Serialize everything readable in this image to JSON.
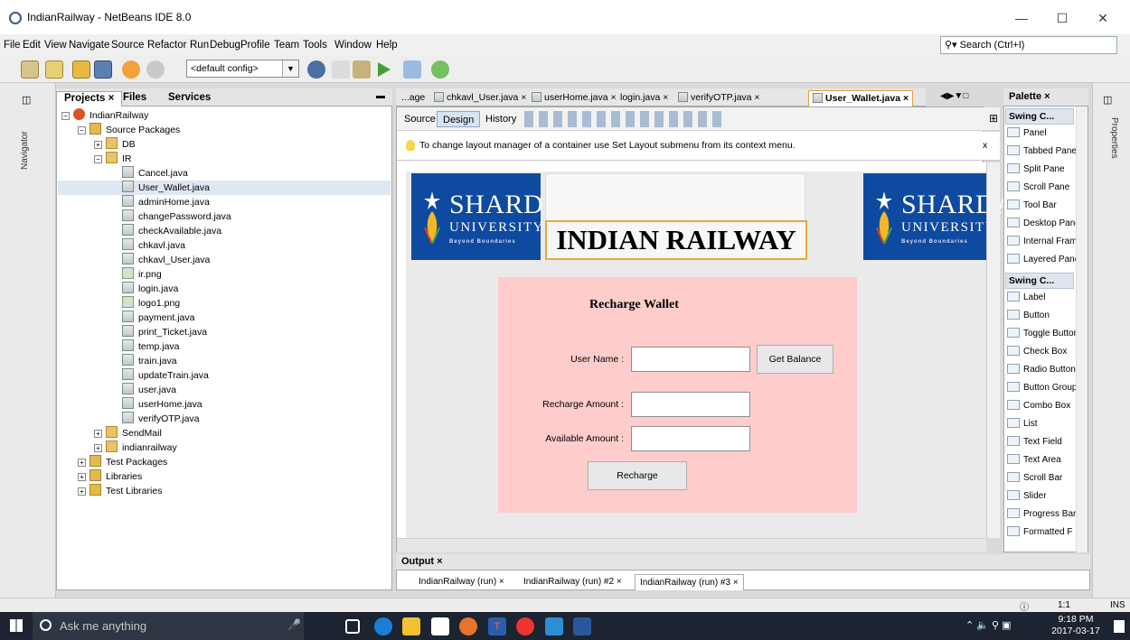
{
  "window": {
    "title": "IndianRailway - NetBeans IDE 8.0",
    "minimize": "—",
    "maximize": "☐",
    "close": "✕"
  },
  "menu": [
    "File",
    "Edit",
    "View",
    "Navigate",
    "Source",
    "Refactor",
    "Run",
    "Debug",
    "Profile",
    "Team",
    "Tools",
    "Window",
    "Help"
  ],
  "search": {
    "placeholder": "Search (Ctrl+I)"
  },
  "toolbar": {
    "config": "<default config>"
  },
  "left_strip": {
    "navigator": "Navigator"
  },
  "projects_panel": {
    "tabs": [
      "Projects ×",
      "Files",
      "Services"
    ],
    "tree": [
      {
        "label": "IndianRailway",
        "type": "proj",
        "level": 0,
        "exp": "−"
      },
      {
        "label": "Source Packages",
        "type": "folder",
        "level": 1,
        "exp": "−"
      },
      {
        "label": "DB",
        "type": "pkg",
        "level": 2,
        "exp": "+"
      },
      {
        "label": "IR",
        "type": "pkg",
        "level": 2,
        "exp": "−"
      },
      {
        "label": "Cancel.java",
        "type": "file",
        "level": 3
      },
      {
        "label": "User_Wallet.java",
        "type": "file",
        "level": 3,
        "selected": true
      },
      {
        "label": "adminHome.java",
        "type": "file",
        "level": 3
      },
      {
        "label": "changePassword.java",
        "type": "file",
        "level": 3
      },
      {
        "label": "checkAvailable.java",
        "type": "file",
        "level": 3
      },
      {
        "label": "chkavl.java",
        "type": "file",
        "level": 3
      },
      {
        "label": "chkavl_User.java",
        "type": "file",
        "level": 3
      },
      {
        "label": "ir.png",
        "type": "img",
        "level": 3
      },
      {
        "label": "login.java",
        "type": "file",
        "level": 3
      },
      {
        "label": "logo1.png",
        "type": "img",
        "level": 3
      },
      {
        "label": "payment.java",
        "type": "file",
        "level": 3
      },
      {
        "label": "print_Ticket.java",
        "type": "file",
        "level": 3
      },
      {
        "label": "temp.java",
        "type": "file",
        "level": 3
      },
      {
        "label": "train.java",
        "type": "file",
        "level": 3
      },
      {
        "label": "updateTrain.java",
        "type": "file",
        "level": 3
      },
      {
        "label": "user.java",
        "type": "file",
        "level": 3
      },
      {
        "label": "userHome.java",
        "type": "file",
        "level": 3
      },
      {
        "label": "verifyOTP.java",
        "type": "file",
        "level": 3
      },
      {
        "label": "SendMail",
        "type": "pkg",
        "level": 2,
        "exp": "+"
      },
      {
        "label": "indianrailway",
        "type": "pkg",
        "level": 2,
        "exp": "+"
      },
      {
        "label": "Test Packages",
        "type": "folder",
        "level": 1,
        "exp": "+"
      },
      {
        "label": "Libraries",
        "type": "folder",
        "level": 1,
        "exp": "+"
      },
      {
        "label": "Test Libraries",
        "type": "folder",
        "level": 1,
        "exp": "+"
      }
    ]
  },
  "editor": {
    "tabs": [
      "...age",
      "chkavl_User.java ×",
      "userHome.java ×",
      "login.java ×",
      "verifyOTP.java ×",
      "User_Wallet.java ×"
    ],
    "views": [
      "Source",
      "Design",
      "History"
    ],
    "hint": "To change layout manager of a container use Set Layout submenu from its context menu.",
    "hint_close": "x"
  },
  "form": {
    "logo_line1": "SHARDA",
    "logo_line2": "UNIVERSITY",
    "logo_line3": "Beyond Boundaries",
    "heading": "INDIAN RAILWAY",
    "panel_title": "Recharge Wallet",
    "user_name_label": "User Name :",
    "get_balance": "Get Balance",
    "recharge_amount_label": "Recharge Amount :",
    "available_amount_label": "Available Amount :",
    "recharge_button": "Recharge"
  },
  "palette": {
    "title": "Palette ×",
    "cat1": "Swing C...",
    "items1": [
      "Panel",
      "Tabbed Pane",
      "Split Pane",
      "Scroll Pane",
      "Tool Bar",
      "Desktop Pane",
      "Internal Frame",
      "Layered Pane"
    ],
    "cat2": "Swing C...",
    "items2": [
      "Label",
      "Button",
      "Toggle Button",
      "Check Box",
      "Radio Button",
      "Button Group",
      "Combo Box",
      "List",
      "Text Field",
      "Text Area",
      "Scroll Bar",
      "Slider",
      "Progress Bar",
      "Formatted F"
    ]
  },
  "right_strip": {
    "properties": "Properties"
  },
  "output": {
    "title": "Output ×",
    "tabs": [
      "IndianRailway (run) ×",
      "IndianRailway (run) #2 ×",
      "IndianRailway (run) #3 ×"
    ]
  },
  "status": {
    "position": "1:1",
    "mode": "INS"
  },
  "taskbar": {
    "search": "Ask me anything",
    "time": "9:18 PM",
    "date": "2017-03-17"
  }
}
